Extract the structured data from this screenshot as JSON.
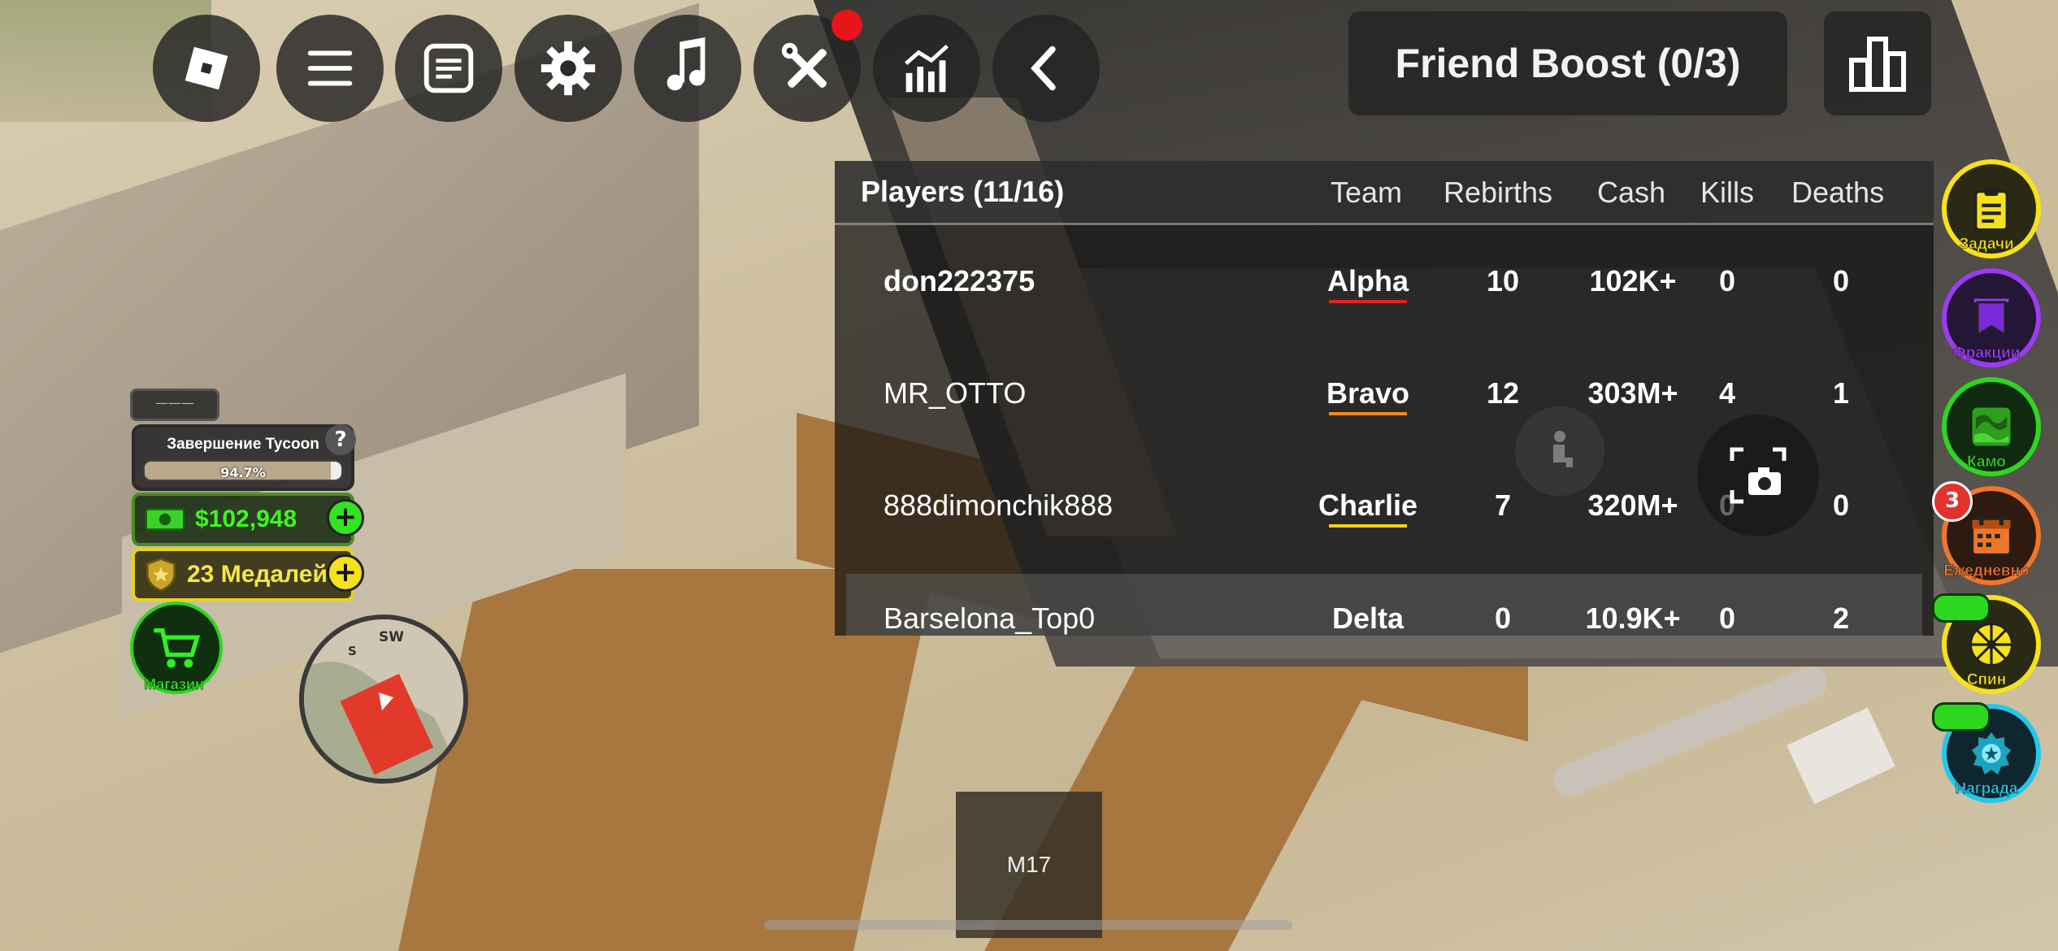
{
  "top_bar": {
    "friend_boost": "Friend Boost (0/3)",
    "tools_has_notification": true
  },
  "player_list": {
    "title": "Players (11/16)",
    "columns": [
      "Team",
      "Rebirths",
      "Cash",
      "Kills",
      "Deaths"
    ],
    "rows": [
      {
        "name": "don222375",
        "team": "Alpha",
        "team_color": "#e32222",
        "rebirths": "10",
        "cash": "102K+",
        "kills": "0",
        "deaths": "0",
        "bold_name": true
      },
      {
        "name": "MR_OTTO",
        "team": "Bravo",
        "team_color": "#f08a24",
        "rebirths": "12",
        "cash": "303M+",
        "kills": "4",
        "deaths": "1",
        "bold_name": false
      },
      {
        "name": "888dimonchik888",
        "team": "Charlie",
        "team_color": "#f2d21d",
        "rebirths": "7",
        "cash": "320M+",
        "kills": "0",
        "deaths": "0",
        "bold_name": false
      },
      {
        "name": "Barselona_Top0",
        "team": "Delta",
        "team_color": "#3fbf56",
        "rebirths": "0",
        "cash": "10.9K+",
        "kills": "0",
        "deaths": "2",
        "bold_name": false
      }
    ]
  },
  "left_hud": {
    "tab_label": "———",
    "tycoon_label": "Завершение Tycoon",
    "tycoon_progress": "94.7%",
    "tycoon_progress_value": 0.947,
    "tycoon_help": "?",
    "money": "$102,948",
    "medals": "23 Медалей",
    "shop_label": "Магазин"
  },
  "minimap": {
    "compass_s": "S",
    "compass_sw": "SW"
  },
  "right_menu": [
    {
      "label": "Задачи",
      "color": "#f5e21a",
      "icon": "clipboard-icon"
    },
    {
      "label": "Фракции",
      "color": "#9a3cf0",
      "icon": "banner-icon"
    },
    {
      "label": "Камо",
      "color": "#2ed61f",
      "icon": "camo-icon"
    },
    {
      "label": "Ежедневно",
      "color": "#f0762a",
      "icon": "calendar-icon"
    },
    {
      "label": "Спин",
      "color": "#f5e21a",
      "icon": "wheel-icon"
    },
    {
      "label": "Награда",
      "color": "#25c7e8",
      "icon": "award-icon"
    }
  ],
  "daily_badge": "3",
  "hotbar": {
    "slot_1": "M17"
  }
}
